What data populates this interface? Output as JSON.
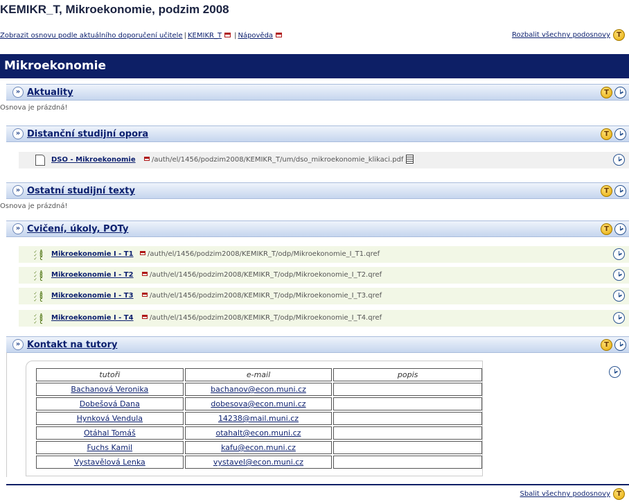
{
  "page": {
    "title": "KEMIKR_T, Mikroekonomie, podzim 2008"
  },
  "topbar": {
    "show_outline_link": "Zobrazit osnovu podle aktuálního doporučení učitele",
    "separator": "|",
    "course_code_link": "KEMIKR_T",
    "help_link": "Nápověda",
    "expand_all_link": "Rozbalit všechny podosnovy"
  },
  "course": {
    "name": "Mikroekonomie"
  },
  "sections": [
    {
      "title": "Aktuality",
      "note": "Osnova je prázdná!"
    },
    {
      "title": "Distanční studijní opora"
    },
    {
      "title": "Ostatní studijní texty",
      "note": "Osnova je prázdná!"
    },
    {
      "title": "Cvičení, úkoly, POTy"
    },
    {
      "title": "Kontakt na tutory"
    }
  ],
  "dso_item": {
    "label": "DSO - Mikroekonomie",
    "path": "/auth/el/1456/podzim2008/KEMIKR_T/um/dso_mikroekonomie_klikaci.pdf"
  },
  "tasks": [
    {
      "label": "Mikroekonomie I - T1",
      "path": "/auth/el/1456/podzim2008/KEMIKR_T/odp/Mikroekonomie_I_T1.qref"
    },
    {
      "label": "Mikroekonomie I - T2",
      "path": "/auth/el/1456/podzim2008/KEMIKR_T/odp/Mikroekonomie_I_T2.qref"
    },
    {
      "label": "Mikroekonomie I - T3",
      "path": "/auth/el/1456/podzim2008/KEMIKR_T/odp/Mikroekonomie_I_T3.qref"
    },
    {
      "label": "Mikroekonomie I - T4",
      "path": "/auth/el/1456/podzim2008/KEMIKR_T/odp/Mikroekonomie_I_T4.qref"
    }
  ],
  "tutors_table": {
    "headers": [
      "tutoři",
      "e-mail",
      "popis"
    ],
    "rows": [
      {
        "name": "Bachanová Veronika",
        "email": "bachanov@econ.muni.cz",
        "desc": ""
      },
      {
        "name": "Dobešová Dana",
        "email": "dobesova@econ.muni.cz",
        "desc": ""
      },
      {
        "name": "Hynková Vendula",
        "email": "14238@mail.muni.cz",
        "desc": ""
      },
      {
        "name": "Otáhal Tomáš",
        "email": "otahalt@econ.muni.cz",
        "desc": ""
      },
      {
        "name": "Fuchs Kamil",
        "email": "kafu@econ.muni.cz",
        "desc": ""
      },
      {
        "name": "Vystavělová Lenka",
        "email": "vystavel@econ.muni.cz",
        "desc": ""
      }
    ]
  },
  "bottom": {
    "collapse_all_link": "Sbalit všechny podosnovy"
  },
  "icons": {
    "badge_letter": "T",
    "chevron": "»"
  },
  "colors": {
    "header_bg": "#0d1f66",
    "link": "#0b1f6e",
    "section_head": "#c6d6ee",
    "task_row": "#f2f7e6"
  }
}
